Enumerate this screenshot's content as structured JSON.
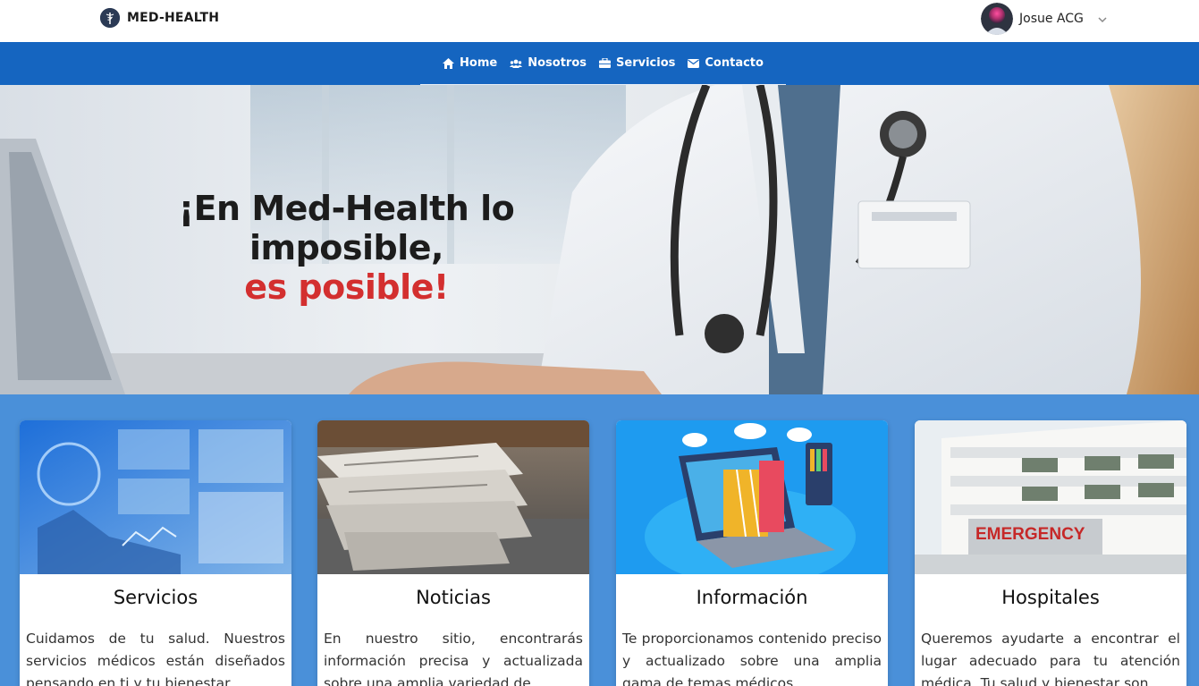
{
  "brand": {
    "name": "MED-HEALTH"
  },
  "user": {
    "name": "Josue ACG"
  },
  "nav": [
    {
      "label": "Home",
      "icon": "home-icon"
    },
    {
      "label": "Nosotros",
      "icon": "users-icon"
    },
    {
      "label": "Servicios",
      "icon": "briefcase-icon"
    },
    {
      "label": "Contacto",
      "icon": "envelope-icon"
    }
  ],
  "hero": {
    "line1": "¡En Med-Health lo",
    "line2": "imposible,",
    "line3": "es posible!"
  },
  "cards": [
    {
      "title": "Servicios",
      "text": "Cuidamos de tu salud. Nuestros servicios médicos están diseñados pensando en ti y tu bienestar."
    },
    {
      "title": "Noticias",
      "text": "En nuestro sitio, encontrarás información precisa y actualizada sobre una amplia variedad de"
    },
    {
      "title": "Información",
      "text": "Te proporcionamos contenido preciso y actualizado sobre una amplia gama de temas médicos."
    },
    {
      "title": "Hospitales",
      "text": "Queremos ayudarte a encontrar el lugar adecuado para tu atención médica. Tu salud y bienestar son"
    }
  ],
  "colors": {
    "nav": "#1565c0",
    "accent_red": "#d32f2f",
    "section_bg": "#4a90d9"
  }
}
